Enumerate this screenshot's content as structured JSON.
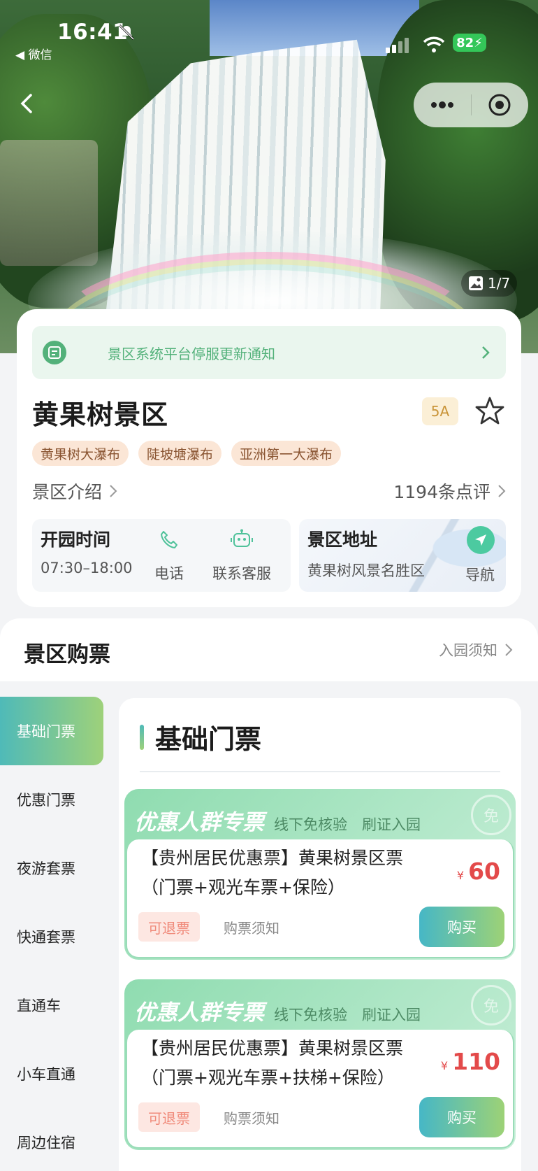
{
  "status_bar": {
    "time": "16:41",
    "back_app": "◀ 微信",
    "battery": "82"
  },
  "hero": {
    "photo_counter": "1/7"
  },
  "notice": {
    "text": "景区系统平台停服更新通知"
  },
  "scenic": {
    "name": "黄果树景区",
    "level": "5A",
    "tags": [
      "黄果树大瀑布",
      "陡坡塘瀑布",
      "亚洲第一大瀑布"
    ],
    "intro_link": "景区介绍",
    "reviews": "1194条点评"
  },
  "hours": {
    "label": "开园时间",
    "value": "07:30–18:00",
    "phone_label": "电话",
    "service_label": "联系客服"
  },
  "address": {
    "label": "景区地址",
    "value": "黄果树风景名胜区",
    "nav_label": "导航"
  },
  "tickets_section": {
    "title": "景区购票",
    "entry_notice": "入园须知"
  },
  "sidebar": {
    "items": [
      {
        "label": "基础门票",
        "active": true
      },
      {
        "label": "优惠门票",
        "active": false
      },
      {
        "label": "夜游套票",
        "active": false
      },
      {
        "label": "快通套票",
        "active": false
      },
      {
        "label": "直通车",
        "active": false
      },
      {
        "label": "小车直通",
        "active": false
      },
      {
        "label": "周边住宿",
        "active": false
      }
    ]
  },
  "content": {
    "title": "基础门票",
    "tickets": [
      {
        "badge": "优惠人群专票",
        "subtitle": "线下免核验　刷证入园",
        "stamp": "免",
        "name": "【贵州居民优惠票】黄果树景区票（门票+观光车票+保险）",
        "currency": "¥",
        "price": "60",
        "refund": "可退票",
        "notes": "购票须知",
        "buy": "购买"
      },
      {
        "badge": "优惠人群专票",
        "subtitle": "线下免核验　刷证入园",
        "stamp": "免",
        "name": "【贵州居民优惠票】黄果树景区票（门票+观光车票+扶梯+保险）",
        "currency": "¥",
        "price": "110",
        "refund": "可退票",
        "notes": "购票须知",
        "buy": "购买"
      }
    ]
  },
  "colors": {
    "accent_green": "#53b17a",
    "price_red": "#e34a4a",
    "gradient_start": "#46b7c6",
    "gradient_end": "#9dd276"
  }
}
